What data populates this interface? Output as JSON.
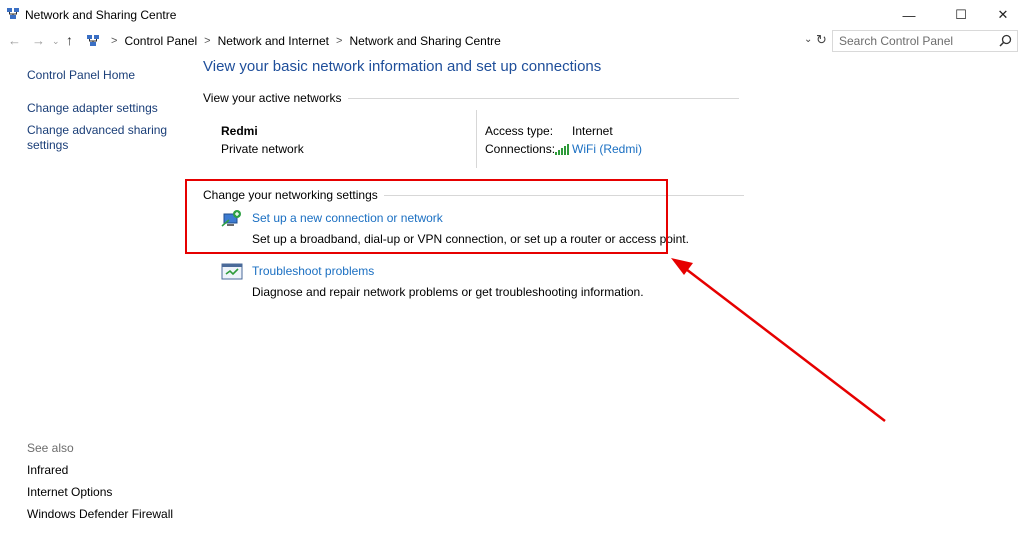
{
  "window": {
    "title": "Network and Sharing Centre",
    "minimize_glyph": "—",
    "maximize_glyph": "☐",
    "close_glyph": "✕"
  },
  "nav": {
    "back_glyph": "←",
    "forward_glyph": "→",
    "recent_glyph": "⌄",
    "up_glyph": "↑"
  },
  "breadcrumb": {
    "sep": ">",
    "items": [
      "Control Panel",
      "Network and Internet",
      "Network and Sharing Centre"
    ]
  },
  "address": {
    "dropdown_glyph": "⌄",
    "refresh_glyph": "↻"
  },
  "search": {
    "placeholder": "Search Control Panel"
  },
  "sidebar": {
    "items": [
      {
        "label": "Control Panel Home"
      },
      {
        "label": "Change adapter settings"
      },
      {
        "label": "Change advanced sharing settings"
      }
    ],
    "see_also": {
      "title": "See also",
      "items": [
        {
          "label": "Infrared"
        },
        {
          "label": "Internet Options"
        },
        {
          "label": "Windows Defender Firewall"
        }
      ]
    }
  },
  "main": {
    "heading": "View your basic network information and set up connections",
    "active_networks": {
      "section_title": "View your active networks",
      "network_name": "Redmi",
      "network_category": "Private network",
      "access_type_label": "Access type:",
      "access_type_value": "Internet",
      "connections_label": "Connections:",
      "connection_link": "WiFi (Redmi)"
    },
    "settings": {
      "section_title": "Change your networking settings",
      "tasks": [
        {
          "link": "Set up a new connection or network",
          "description": "Set up a broadband, dial-up or VPN connection, or set up a router or access point."
        },
        {
          "link": "Troubleshoot problems",
          "description": "Diagnose and repair network problems or get troubleshooting information."
        }
      ]
    }
  },
  "colors": {
    "heading": "#1e4e9a",
    "link": "#1a6fc2",
    "sidebar_link": "#1a3e78",
    "annotation": "#e60000"
  }
}
